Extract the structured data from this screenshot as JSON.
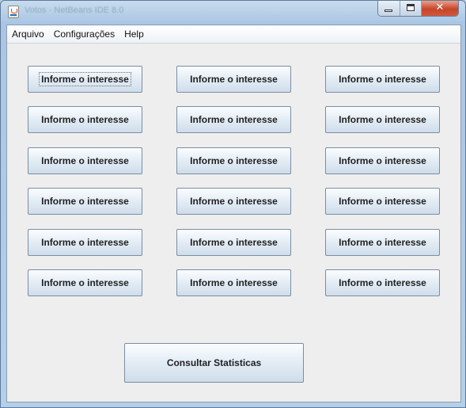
{
  "window": {
    "title": "Votos - NetBeans IDE 8.0"
  },
  "menubar": {
    "items": [
      "Arquivo",
      "Configurações",
      "Help"
    ]
  },
  "grid": {
    "button_label": "Informe o interesse",
    "rows": 6,
    "columns": 3
  },
  "action": {
    "consult_label": "Consultar Statisticas"
  }
}
